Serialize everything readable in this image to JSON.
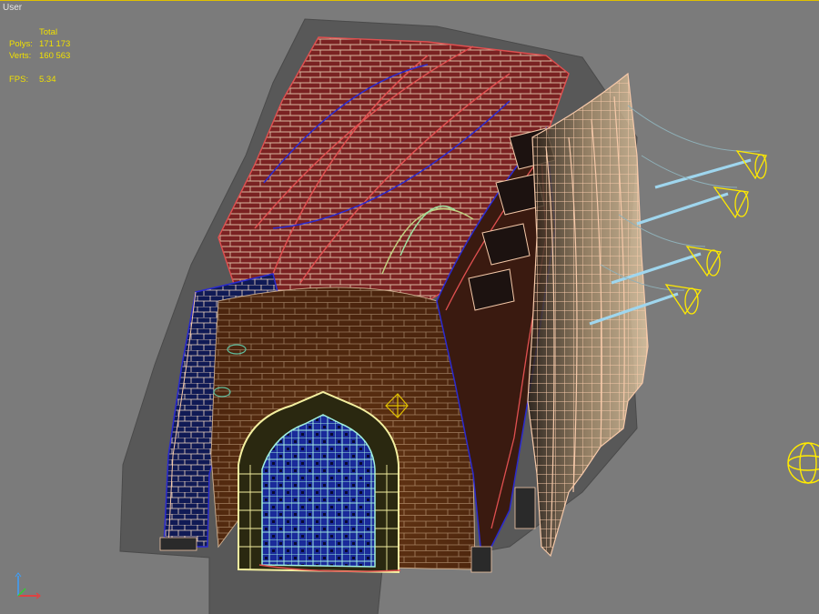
{
  "viewport": {
    "label": "User",
    "stats": {
      "header": "Total",
      "polys_label": "Polys:",
      "polys_value": "171 173",
      "verts_label": "Verts:",
      "verts_value": "160 563",
      "fps_label": "FPS:",
      "fps_value": "5.34"
    }
  },
  "colors": {
    "background": "#7b7b7b",
    "viewport_border": "#e0c000",
    "stats_text": "#f0e000",
    "shell": "#5a5a5a",
    "vault_red": "#8c2a2a",
    "wire_red": "#e05050",
    "wire_blue": "#2a2ad0",
    "wire_peach": "#f4c8a8",
    "wire_yellow": "#f0f0a0",
    "light_cyan": "#9fd6ee",
    "spot_yellow": "#ffea00"
  },
  "icons": {
    "axis_gizmo": "xyz-axis-icon",
    "spotlight": "spotlight-cone-icon",
    "omni_light": "omni-light-icon"
  }
}
